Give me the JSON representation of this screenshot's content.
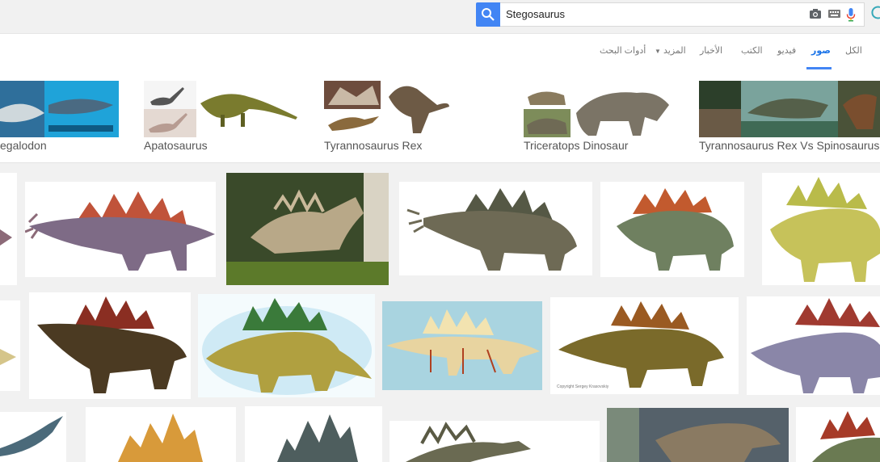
{
  "search": {
    "query": "Stegosaurus"
  },
  "tabs": [
    {
      "label": "الكل"
    },
    {
      "label": "صور"
    },
    {
      "label": "فيديو"
    },
    {
      "label": "الكتب"
    },
    {
      "label": "الأخبار"
    },
    {
      "label": "المزيد"
    },
    {
      "label": "أدوات البحث"
    }
  ],
  "related": [
    {
      "label": "egalodon"
    },
    {
      "label": "Apatosaurus"
    },
    {
      "label": "Tyrannosaurus Rex"
    },
    {
      "label": "Triceratops Dinosaur"
    },
    {
      "label": "Tyrannosaurus Rex Vs Spinosaurus"
    }
  ],
  "image_caption": "Copyright Sergey Krasovskiy"
}
